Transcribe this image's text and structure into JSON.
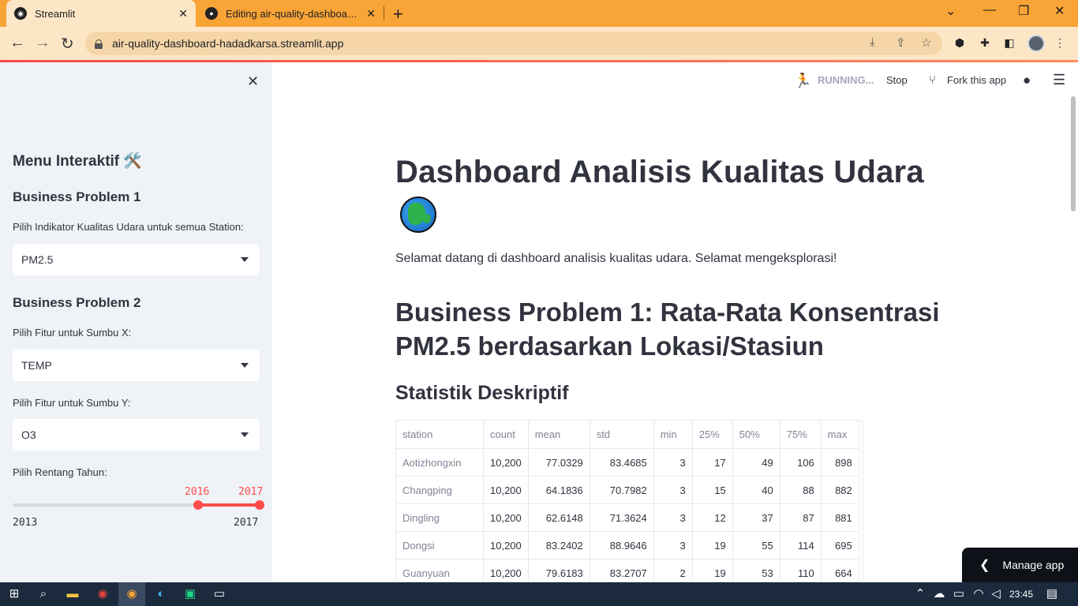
{
  "browser": {
    "tabs": [
      {
        "title": "Streamlit",
        "active": true
      },
      {
        "title": "Editing air-quality-dashboard/RE",
        "active": false
      }
    ],
    "url": "air-quality-dashboard-hadadkarsa.streamlit.app"
  },
  "app_header": {
    "status": "RUNNING...",
    "stop": "Stop",
    "fork": "Fork this app"
  },
  "sidebar": {
    "menu_title": "Menu Interaktif 🛠️",
    "bp1_title": "Business Problem 1",
    "bp1_label": "Pilih Indikator Kualitas Udara untuk semua Station:",
    "bp1_value": "PM2.5",
    "bp2_title": "Business Problem 2",
    "x_label": "Pilih Fitur untuk Sumbu X:",
    "x_value": "TEMP",
    "y_label": "Pilih Fitur untuk Sumbu Y:",
    "y_value": "O3",
    "range_label": "Pilih Rentang Tahun:",
    "range_low": "2016",
    "range_high": "2017",
    "range_min": "2013",
    "range_max": "2017",
    "range_fraction_low": 0.75,
    "range_fraction_high": 1.0
  },
  "main": {
    "title": "Dashboard Analisis Kualitas Udara",
    "intro": "Selamat datang di dashboard analisis kualitas udara. Selamat mengeksplorasi!",
    "bp1_heading": "Business Problem 1: Rata-Rata Konsentrasi PM2.5 berdasarkan Lokasi/Stasiun",
    "stats_heading": "Statistik Deskriptif",
    "table": {
      "columns": [
        "station",
        "count",
        "mean",
        "std",
        "min",
        "25%",
        "50%",
        "75%",
        "max"
      ],
      "rows": [
        [
          "Aotizhongxin",
          "10,200",
          "77.0329",
          "83.4685",
          "3",
          "17",
          "49",
          "106",
          "898"
        ],
        [
          "Changping",
          "10,200",
          "64.1836",
          "70.7982",
          "3",
          "15",
          "40",
          "88",
          "882"
        ],
        [
          "Dingling",
          "10,200",
          "62.6148",
          "71.3624",
          "3",
          "12",
          "37",
          "87",
          "881"
        ],
        [
          "Dongsi",
          "10,200",
          "83.2402",
          "88.9646",
          "3",
          "19",
          "55",
          "114",
          "695"
        ],
        [
          "Guanyuan",
          "10,200",
          "79.6183",
          "83.2707",
          "2",
          "19",
          "53",
          "110",
          "664"
        ]
      ]
    }
  },
  "manage_app": "Manage app",
  "taskbar": {
    "time": "23:45"
  },
  "colors": {
    "accent": "#ff4b4b",
    "chrome_tab": "#f9a436",
    "sidebar_bg": "#eff2f6"
  }
}
